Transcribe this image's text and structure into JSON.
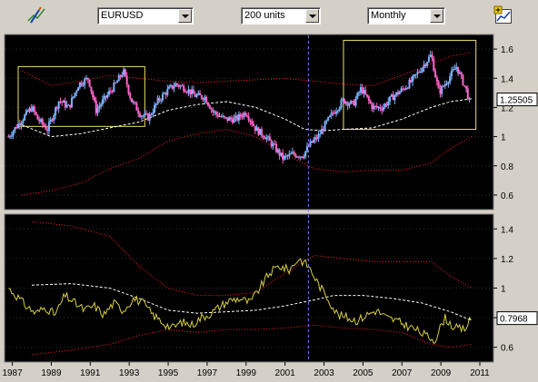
{
  "toolbar": {
    "symbol": "EURUSD",
    "units": "200 units",
    "period": "Monthly",
    "draw_tool_icon": "pencil-chart-icon",
    "add_indicator_icon": "add-chart-icon"
  },
  "colors": {
    "background": "#000000",
    "ui": "#d4d0c8",
    "candle_up": "#7fb3ff",
    "candle_down": "#ff66cc",
    "band": "#ff2020",
    "mean": "#ffffff",
    "oscillator": "#d8d040",
    "highlight_box": "#f0e060",
    "cursor": "#8080ff"
  },
  "chart_data": [
    {
      "type": "candlestick",
      "panel": "upper",
      "ylim": [
        0.5,
        1.7
      ],
      "y_ticks": [
        "0.6",
        "0.8",
        "1",
        "1.2",
        "1.4",
        "1.6"
      ],
      "last_value_label": "1.25505",
      "x_ticks": [
        "1987",
        "1989",
        "1991",
        "1993",
        "1995",
        "1997",
        "1999",
        "2001",
        "2003",
        "2005",
        "2007",
        "2009",
        "2011"
      ],
      "xlim": [
        1986.6,
        2011.7
      ],
      "price": [
        [
          1986.8,
          1.0
        ],
        [
          1987.5,
          1.12
        ],
        [
          1988.0,
          1.2
        ],
        [
          1988.3,
          1.12
        ],
        [
          1988.8,
          1.05
        ],
        [
          1989.4,
          1.25
        ],
        [
          1989.9,
          1.2
        ],
        [
          1990.4,
          1.36
        ],
        [
          1990.9,
          1.4
        ],
        [
          1991.3,
          1.18
        ],
        [
          1991.8,
          1.27
        ],
        [
          1992.3,
          1.36
        ],
        [
          1992.7,
          1.45
        ],
        [
          1993.1,
          1.25
        ],
        [
          1993.6,
          1.15
        ],
        [
          1994.0,
          1.13
        ],
        [
          1994.5,
          1.25
        ],
        [
          1995.0,
          1.32
        ],
        [
          1995.4,
          1.36
        ],
        [
          1995.9,
          1.33
        ],
        [
          1996.4,
          1.28
        ],
        [
          1996.9,
          1.27
        ],
        [
          1997.3,
          1.17
        ],
        [
          1997.9,
          1.12
        ],
        [
          1998.5,
          1.12
        ],
        [
          1999.0,
          1.17
        ],
        [
          1999.5,
          1.05
        ],
        [
          2000.0,
          1.0
        ],
        [
          2000.5,
          0.92
        ],
        [
          2000.9,
          0.85
        ],
        [
          2001.4,
          0.88
        ],
        [
          2001.9,
          0.87
        ],
        [
          2002.3,
          0.95
        ],
        [
          2002.7,
          1.0
        ],
        [
          2003.0,
          1.07
        ],
        [
          2003.5,
          1.17
        ],
        [
          2004.0,
          1.25
        ],
        [
          2004.5,
          1.22
        ],
        [
          2004.9,
          1.33
        ],
        [
          2005.5,
          1.2
        ],
        [
          2006.0,
          1.2
        ],
        [
          2006.5,
          1.27
        ],
        [
          2007.0,
          1.32
        ],
        [
          2007.5,
          1.38
        ],
        [
          2008.0,
          1.47
        ],
        [
          2008.5,
          1.56
        ],
        [
          2008.9,
          1.3
        ],
        [
          2009.3,
          1.38
        ],
        [
          2009.8,
          1.48
        ],
        [
          2010.3,
          1.32
        ],
        [
          2010.5,
          1.22
        ]
      ],
      "mean": [
        [
          1987.5,
          1.08
        ],
        [
          1989.0,
          1.0
        ],
        [
          1990.5,
          1.02
        ],
        [
          1992.0,
          1.06
        ],
        [
          1993.5,
          1.1
        ],
        [
          1995.0,
          1.18
        ],
        [
          1996.5,
          1.22
        ],
        [
          1998.0,
          1.24
        ],
        [
          1999.5,
          1.2
        ],
        [
          2001.0,
          1.12
        ],
        [
          2002.0,
          1.05
        ],
        [
          2003.0,
          1.04
        ],
        [
          2004.0,
          1.05
        ],
        [
          2005.5,
          1.06
        ],
        [
          2007.0,
          1.12
        ],
        [
          2008.5,
          1.2
        ],
        [
          2009.5,
          1.24
        ],
        [
          2010.6,
          1.26
        ]
      ],
      "upper_band": [
        [
          1987.5,
          1.45
        ],
        [
          1989.0,
          1.35
        ],
        [
          1990.5,
          1.38
        ],
        [
          1992.0,
          1.42
        ],
        [
          1993.5,
          1.4
        ],
        [
          1995.0,
          1.38
        ],
        [
          1996.5,
          1.37
        ],
        [
          1998.0,
          1.38
        ],
        [
          1999.5,
          1.39
        ],
        [
          2001.0,
          1.4
        ],
        [
          2002.5,
          1.38
        ],
        [
          2004.0,
          1.36
        ],
        [
          2005.5,
          1.35
        ],
        [
          2007.0,
          1.42
        ],
        [
          2008.5,
          1.5
        ],
        [
          2009.5,
          1.55
        ],
        [
          2010.6,
          1.58
        ]
      ],
      "lower_band": [
        [
          1987.5,
          0.6
        ],
        [
          1989.0,
          0.63
        ],
        [
          1990.5,
          0.68
        ],
        [
          1992.0,
          0.78
        ],
        [
          1993.5,
          0.85
        ],
        [
          1995.0,
          0.97
        ],
        [
          1996.5,
          1.02
        ],
        [
          1998.0,
          1.05
        ],
        [
          1999.5,
          1.0
        ],
        [
          2001.0,
          0.88
        ],
        [
          2002.5,
          0.78
        ],
        [
          2004.0,
          0.76
        ],
        [
          2005.5,
          0.77
        ],
        [
          2007.0,
          0.77
        ],
        [
          2008.5,
          0.82
        ],
        [
          2009.5,
          0.92
        ],
        [
          2010.6,
          1.0
        ]
      ],
      "highlight_boxes": [
        {
          "x": [
            1987.3,
            1993.8
          ],
          "y": [
            1.07,
            1.48
          ]
        },
        {
          "x": [
            2004.0,
            2010.8
          ],
          "y": [
            1.05,
            1.66
          ]
        }
      ]
    },
    {
      "type": "line",
      "panel": "lower",
      "ylim": [
        0.5,
        1.5
      ],
      "y_ticks": [
        "0.6",
        "0.8",
        "1",
        "1.2",
        "1.4"
      ],
      "last_value_label": "0.7968",
      "x": [
        1986.8,
        1987.2,
        1987.7,
        1988.2,
        1988.7,
        1989.2,
        1989.7,
        1990.2,
        1990.7,
        1991.2,
        1991.7,
        1992.2,
        1992.7,
        1993.2,
        1993.7,
        1994.2,
        1994.7,
        1995.2,
        1995.7,
        1996.2,
        1996.7,
        1997.2,
        1997.7,
        1998.2,
        1998.7,
        1999.2,
        1999.7,
        2000.2,
        2000.7,
        2001.2,
        2001.7,
        2002.2,
        2002.7,
        2003.2,
        2003.7,
        2004.2,
        2004.7,
        2005.2,
        2005.7,
        2006.2,
        2006.7,
        2007.2,
        2007.7,
        2008.2,
        2008.7,
        2009.2,
        2009.7,
        2010.2,
        2010.6
      ],
      "y": [
        1.0,
        0.95,
        0.88,
        0.83,
        0.87,
        0.82,
        0.95,
        0.9,
        0.85,
        0.88,
        0.82,
        0.9,
        0.85,
        0.93,
        0.9,
        0.82,
        0.77,
        0.73,
        0.77,
        0.75,
        0.8,
        0.83,
        0.88,
        0.92,
        0.93,
        0.9,
        1.0,
        1.1,
        1.15,
        1.12,
        1.2,
        1.15,
        1.03,
        0.93,
        0.82,
        0.8,
        0.78,
        0.82,
        0.85,
        0.8,
        0.78,
        0.75,
        0.72,
        0.68,
        0.65,
        0.8,
        0.73,
        0.72,
        0.8
      ],
      "mean": [
        [
          1988.0,
          1.02
        ],
        [
          1990.0,
          1.03
        ],
        [
          1992.0,
          1.0
        ],
        [
          1993.5,
          0.93
        ],
        [
          1995.0,
          0.85
        ],
        [
          1996.5,
          0.83
        ],
        [
          1998.0,
          0.84
        ],
        [
          1999.5,
          0.85
        ],
        [
          2001.0,
          0.88
        ],
        [
          2002.5,
          0.92
        ],
        [
          2003.5,
          0.95
        ],
        [
          2005.0,
          0.95
        ],
        [
          2006.5,
          0.93
        ],
        [
          2008.0,
          0.9
        ],
        [
          2009.5,
          0.84
        ],
        [
          2010.6,
          0.78
        ]
      ],
      "upper_band": [
        [
          1988.0,
          1.45
        ],
        [
          1990.0,
          1.42
        ],
        [
          1992.0,
          1.35
        ],
        [
          1993.5,
          1.15
        ],
        [
          1995.0,
          1.0
        ],
        [
          1996.5,
          0.95
        ],
        [
          1998.0,
          0.95
        ],
        [
          1999.5,
          0.97
        ],
        [
          2001.0,
          1.1
        ],
        [
          2002.5,
          1.22
        ],
        [
          2004.0,
          1.2
        ],
        [
          2005.5,
          1.18
        ],
        [
          2007.0,
          1.18
        ],
        [
          2008.5,
          1.18
        ],
        [
          2009.5,
          1.08
        ],
        [
          2010.6,
          1.0
        ]
      ],
      "lower_band": [
        [
          1988.0,
          0.55
        ],
        [
          1990.0,
          0.58
        ],
        [
          1992.0,
          0.62
        ],
        [
          1993.5,
          0.68
        ],
        [
          1995.0,
          0.72
        ],
        [
          1996.5,
          0.7
        ],
        [
          1998.0,
          0.72
        ],
        [
          1999.5,
          0.72
        ],
        [
          2001.0,
          0.73
        ],
        [
          2002.5,
          0.75
        ],
        [
          2004.0,
          0.73
        ],
        [
          2005.5,
          0.72
        ],
        [
          2007.0,
          0.7
        ],
        [
          2008.5,
          0.62
        ],
        [
          2009.5,
          0.6
        ],
        [
          2010.6,
          0.62
        ]
      ]
    }
  ]
}
